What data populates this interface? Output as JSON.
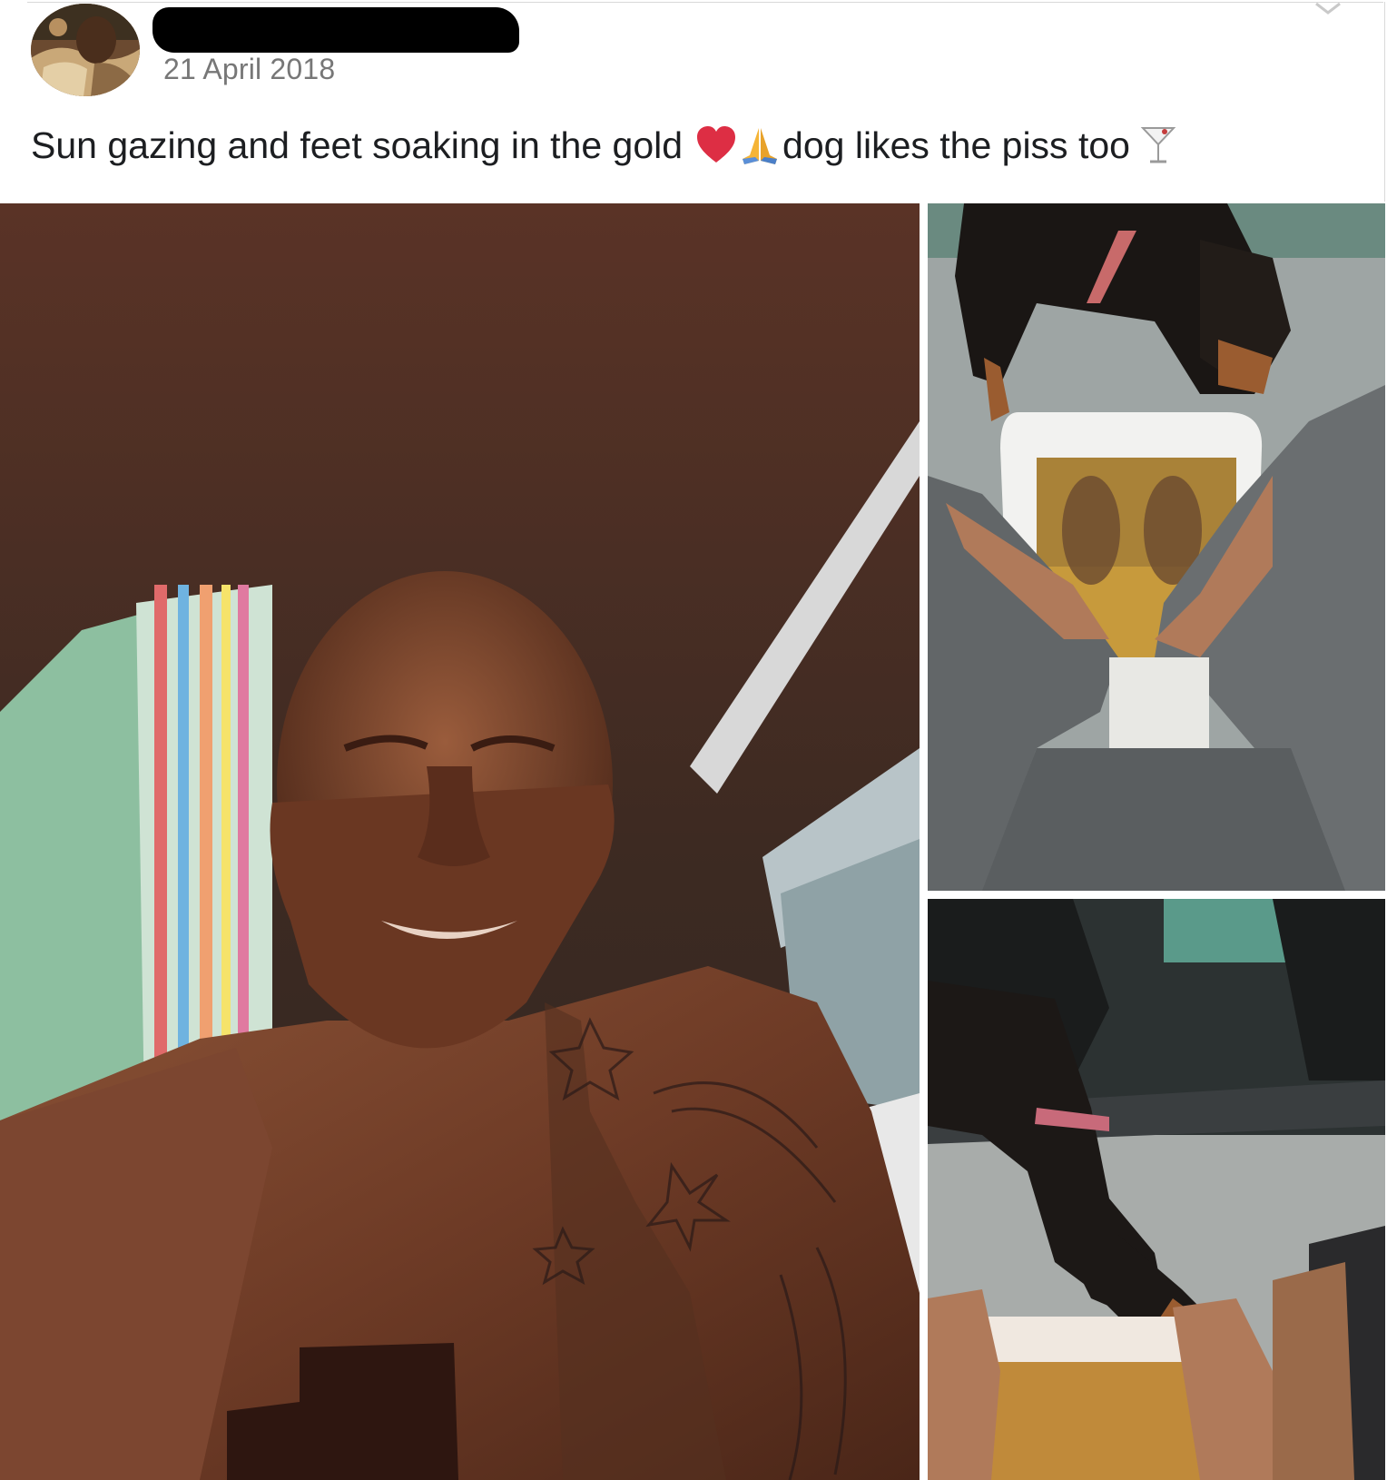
{
  "post": {
    "author_redacted": true,
    "date": "21 April 2018",
    "caption": {
      "part1": "Sun gazing and feet soaking in the gold",
      "part2": "dog likes the piss too"
    },
    "caption_icons": [
      "red-heart-icon",
      "folded-hands-icon",
      "cocktail-glass-icon"
    ],
    "photos": {
      "main": "photo-shirtless-selfie",
      "top_right": "photo-feet-soak-with-dog",
      "bottom_right": "photo-dog-at-tub"
    }
  }
}
